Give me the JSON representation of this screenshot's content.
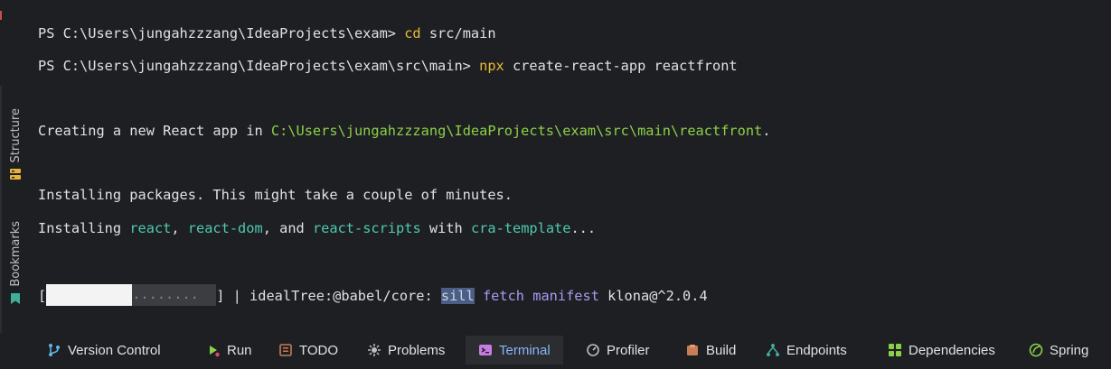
{
  "sidebar": {
    "tabs": [
      {
        "label": "Structure",
        "icon": "structure-icon"
      },
      {
        "label": "Bookmarks",
        "icon": "bookmark-icon"
      }
    ]
  },
  "terminal": {
    "lines": [
      {
        "prompt": "PS C:\\Users\\jungahzzzang\\IdeaProjects\\exam> ",
        "cmd": "cd",
        "args": " src/main"
      },
      {
        "prompt": "PS C:\\Users\\jungahzzzang\\IdeaProjects\\exam\\src\\main> ",
        "cmd": "npx",
        "args": " create-react-app reactfront"
      },
      {
        "pre": "Creating a new React app in ",
        "path": "C:\\Users\\jungahzzzang\\IdeaProjects\\exam\\src\\main\\reactfront",
        "post": "."
      },
      {
        "text": "Installing packages. This might take a couple of minutes."
      },
      {
        "pre": "Installing ",
        "p1": "react",
        "s1": ", ",
        "p2": "react-dom",
        "s2": ", and ",
        "p3": "react-scripts",
        "s3": " with ",
        "p4": "cra-template",
        "s4": "..."
      },
      {
        "open": "[",
        "dots": "........",
        "close": "] | idealTree:@babel/core: ",
        "level": "sill",
        "w1": "fetch",
        "w2": "manifest",
        "pkg": "klona@^2.0.4"
      }
    ],
    "progress": 0.5
  },
  "toolbar": {
    "items": [
      {
        "label": "Version Control",
        "icon": "version-control-icon"
      },
      {
        "label": "Run",
        "icon": "run-icon"
      },
      {
        "label": "TODO",
        "icon": "todo-icon"
      },
      {
        "label": "Problems",
        "icon": "problems-icon"
      },
      {
        "label": "Terminal",
        "icon": "terminal-icon",
        "active": true
      },
      {
        "label": "Profiler",
        "icon": "profiler-icon"
      },
      {
        "label": "Build",
        "icon": "build-icon"
      },
      {
        "label": "Endpoints",
        "icon": "endpoints-icon"
      },
      {
        "label": "Dependencies",
        "icon": "dependencies-icon"
      },
      {
        "label": "Spring",
        "icon": "spring-icon"
      }
    ]
  },
  "colors": {
    "background": "#1e1f22",
    "text": "#dfe1e5",
    "command": "#e8ba36",
    "path": "#8bd049",
    "package": "#4ec9b0",
    "log_word": "#a89af5",
    "active_tab": "#8ab4f8"
  }
}
